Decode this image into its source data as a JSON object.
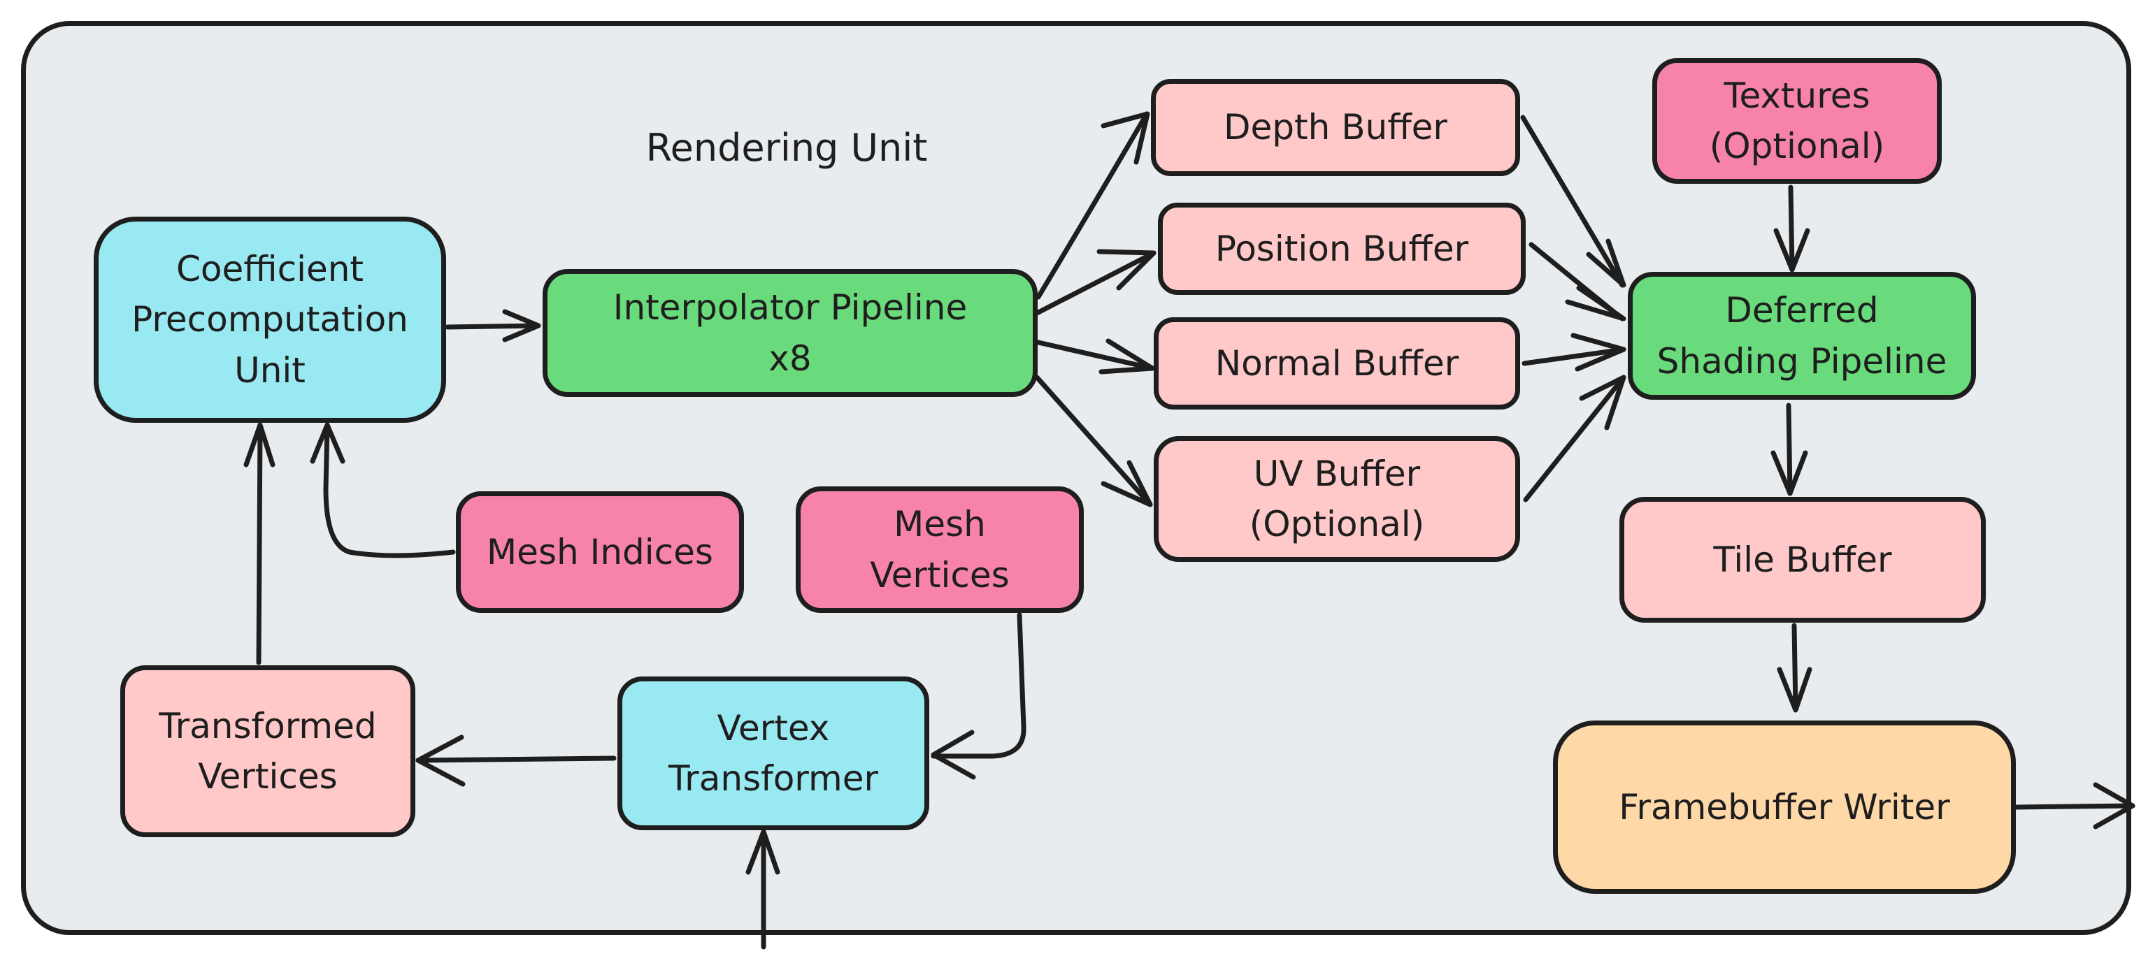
{
  "diagram": {
    "title": "Rendering Unit",
    "colors": {
      "background": "#e9ecef",
      "stroke": "#1e1e1e",
      "cyan": "#99e9f2",
      "green": "#69db7c",
      "light_pink": "#ffc9c9",
      "pink": "#f783ac",
      "orange": "#ffd8a8"
    },
    "nodes": {
      "coefficient": {
        "label": "Coefficient\nPrecomputation\nUnit",
        "color": "#99e9f2"
      },
      "interpolator": {
        "label": "Interpolator Pipeline\nx8",
        "color": "#69db7c"
      },
      "depth_buffer": {
        "label": "Depth Buffer",
        "color": "#ffc9c9"
      },
      "position_buffer": {
        "label": "Position Buffer",
        "color": "#ffc9c9"
      },
      "normal_buffer": {
        "label": "Normal Buffer",
        "color": "#ffc9c9"
      },
      "uv_buffer": {
        "label": "UV Buffer\n(Optional)",
        "color": "#ffc9c9"
      },
      "textures": {
        "label": "Textures\n(Optional)",
        "color": "#f783ac"
      },
      "deferred": {
        "label": "Deferred\nShading Pipeline",
        "color": "#69db7c"
      },
      "tile_buffer": {
        "label": "Tile Buffer",
        "color": "#ffc9c9"
      },
      "framebuffer_writer": {
        "label": "Framebuffer Writer",
        "color": "#ffd8a8"
      },
      "mesh_indices": {
        "label": "Mesh Indices",
        "color": "#f783ac"
      },
      "mesh_vertices": {
        "label": "Mesh\nVertices",
        "color": "#f783ac"
      },
      "transformed_vertices": {
        "label": "Transformed\nVertices",
        "color": "#ffc9c9"
      },
      "vertex_transformer": {
        "label": "Vertex\nTransformer",
        "color": "#99e9f2"
      }
    },
    "edges": [
      {
        "from": "coefficient",
        "to": "interpolator"
      },
      {
        "from": "interpolator",
        "to": "depth_buffer"
      },
      {
        "from": "interpolator",
        "to": "position_buffer"
      },
      {
        "from": "interpolator",
        "to": "normal_buffer"
      },
      {
        "from": "interpolator",
        "to": "uv_buffer"
      },
      {
        "from": "depth_buffer",
        "to": "deferred"
      },
      {
        "from": "position_buffer",
        "to": "deferred"
      },
      {
        "from": "normal_buffer",
        "to": "deferred"
      },
      {
        "from": "uv_buffer",
        "to": "deferred"
      },
      {
        "from": "textures",
        "to": "deferred"
      },
      {
        "from": "deferred",
        "to": "tile_buffer"
      },
      {
        "from": "tile_buffer",
        "to": "framebuffer_writer"
      },
      {
        "from": "framebuffer_writer",
        "to": "external-output"
      },
      {
        "from": "mesh_indices",
        "to": "coefficient"
      },
      {
        "from": "transformed_vertices",
        "to": "coefficient"
      },
      {
        "from": "vertex_transformer",
        "to": "transformed_vertices"
      },
      {
        "from": "mesh_vertices",
        "to": "vertex_transformer"
      },
      {
        "from": "external-input",
        "to": "vertex_transformer"
      }
    ]
  }
}
